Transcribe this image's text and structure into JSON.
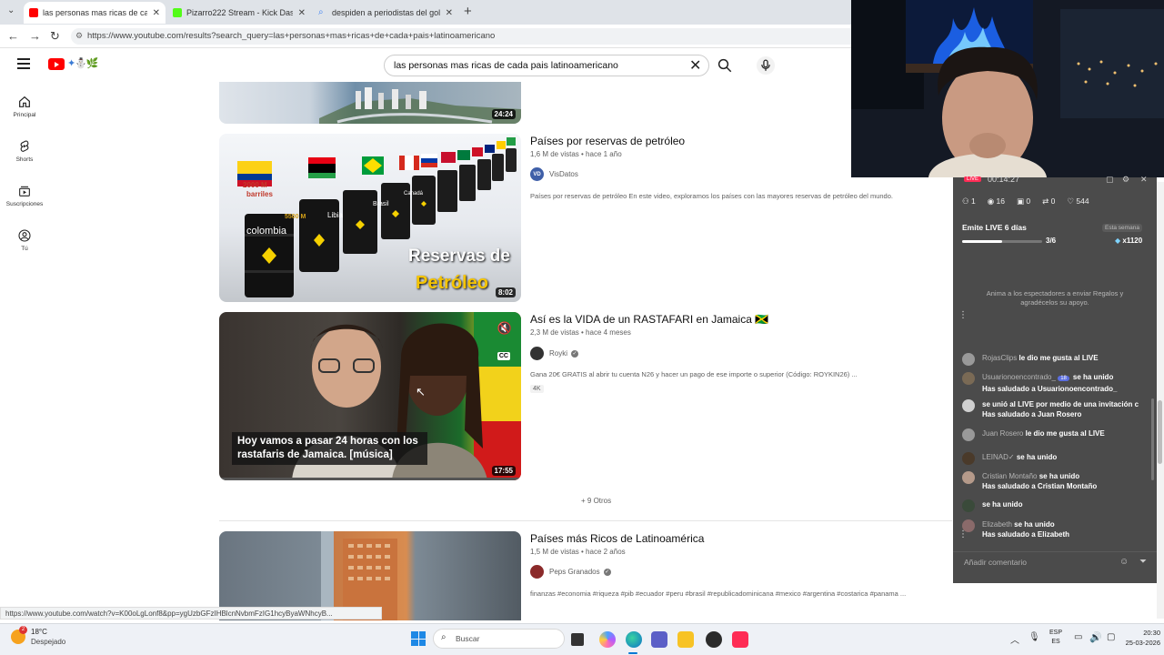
{
  "browser": {
    "tabs": [
      {
        "label": "las personas mas ricas de cada pa",
        "active": true,
        "favicon_color": "#ff0000"
      },
      {
        "label": "Pizarro222 Stream - Kick Dashboa",
        "active": false,
        "favicon_color": "#53fc18"
      },
      {
        "label": "despiden a periodistas del gol car",
        "active": false,
        "favicon_color": "#4285f4"
      }
    ],
    "url": "https://www.youtube.com/results?search_query=las+personas+mas+ricas+de+cada+pais+latinoamericano"
  },
  "youtube": {
    "search_query": "las personas mas ricas de cada pais latinoamericano",
    "rail": [
      {
        "label": "Principal",
        "icon": "home-icon"
      },
      {
        "label": "Shorts",
        "icon": "shorts-icon"
      },
      {
        "label": "Suscripciones",
        "icon": "subscriptions-icon"
      },
      {
        "label": "Tú",
        "icon": "account-icon"
      }
    ],
    "results": [
      {
        "duration": "24:24"
      },
      {
        "title": "Países por reservas de petróleo",
        "meta": "1,6 M de vistas • hace 1 año",
        "channel": "VisDatos",
        "channel_avatar_text": "VD",
        "description": "Países por reservas de petróleo En este video, exploramos los países con las mayores reservas de petróleo del mundo.",
        "duration": "8:02",
        "thumb_text_1": "Reservas de",
        "thumb_text_2": "Petróleo",
        "barrel_label": "colombia",
        "barrel_label_2": "Libia",
        "barrel_label_3": "Brasil",
        "barrel_label_4": "Canadá",
        "barrel_figure": "2000 M",
        "barrel_unit": "barriles",
        "barrel_figure_2": "5500 M"
      },
      {
        "title": "Así es la VIDA de un RASTAFARI en Jamaica 🇯🇲",
        "meta": "2,3 M de vistas • hace 4 meses",
        "channel": "Royki",
        "description": "Gana 20€ GRATIS al abrir tu cuenta N26 y hacer un pago de ese importe o superior (Código: ROYKIN26) ...",
        "badge": "4K",
        "caption": "Hoy vamos a pasar 24 horas con los rastafaris de Jamaica. [música]",
        "duration": "17:55",
        "cc": "CC"
      },
      {
        "title": "Países más Ricos de Latinoamérica",
        "meta": "1,5 M de vistas • hace 2 años",
        "channel": "Peps Granados",
        "description": "finanzas #economia #riqueza #pib #ecuador #peru #brasil #republicadominicana #mexico #argentina #costarica #panama ..."
      }
    ],
    "more_label": "+ 9 Otros"
  },
  "status_url": "https://www.youtube.com/watch?v=K00oLgLonf8&pp=ygUzbGFzIHBlcnNvbmFzIG1hcyByaWNhcyB...",
  "live_panel": {
    "timer": "00:14:27",
    "stats": [
      {
        "icon": "viewers-icon",
        "value": "1"
      },
      {
        "icon": "eye-icon",
        "value": "16"
      },
      {
        "icon": "gift-icon",
        "value": "0"
      },
      {
        "icon": "share-icon",
        "value": "0"
      },
      {
        "icon": "heart-icon",
        "value": "544"
      }
    ],
    "streak_title": "Emite LIVE 6 días",
    "streak_badge": "Esta semana",
    "streak_progress": "3/6",
    "streak_fraction": 0.5,
    "reward": "x1120",
    "promo": "Anima a los espectadores a enviar Regalos y agradécelos su apoyo.",
    "chat": [
      {
        "name": "RojasClips",
        "msg": "le dio me gusta al LIVE",
        "sub": "",
        "avatar": "#999999"
      },
      {
        "name": "Usuarionoencontrado_",
        "msg": "se ha unido",
        "sub": "Has saludado a Usuarionoencontrado_",
        "avatar": "#7a6a55",
        "badge": "18"
      },
      {
        "name": "",
        "msg": "se unió al LIVE por medio de una invitación c",
        "sub": "Has saludado a Juan Rosero",
        "avatar": "#d0d0d0"
      },
      {
        "name": "Juan Rosero",
        "msg": "le dio me gusta al LIVE",
        "sub": "",
        "avatar": "#999999"
      },
      {
        "name": "LEINAD✓",
        "msg": "se ha unido",
        "sub": "",
        "avatar": "#4a3a2a"
      },
      {
        "name": "Cristian Montaño",
        "msg": "se ha unido",
        "sub": "Has saludado a Cristian Montaño",
        "avatar": "#b59a8a"
      },
      {
        "name": "",
        "msg": "se ha unido",
        "sub": "",
        "avatar": "#3a4a3a"
      },
      {
        "name": "Elizabeth",
        "msg": "se ha unido",
        "sub": "Has saludado a Elizabeth",
        "avatar": "#8a6a6a"
      }
    ],
    "comment_placeholder": "Añadir comentario"
  },
  "taskbar": {
    "weather_temp": "18°C",
    "weather_desc": "Despejado",
    "weather_badge": "2",
    "search_placeholder": "Buscar",
    "lang_1": "ESP",
    "lang_2": "ES",
    "time": "20:30",
    "date": "25-03-2026"
  }
}
